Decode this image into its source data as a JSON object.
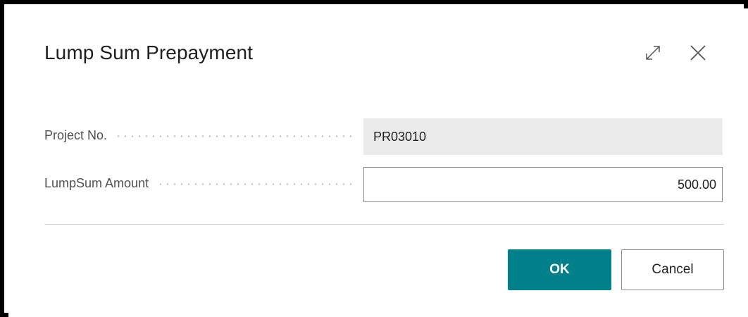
{
  "dialog": {
    "title": "Lump Sum Prepayment",
    "expand_icon": "expand-icon",
    "close_icon": "close-icon"
  },
  "fields": {
    "project_no": {
      "label": "Project No.",
      "value": "PR03010"
    },
    "lumpsum_amount": {
      "label": "LumpSum Amount",
      "value": "500.00"
    }
  },
  "buttons": {
    "ok_label": "OK",
    "cancel_label": "Cancel"
  },
  "colors": {
    "accent": "#00808a",
    "readonly_bg": "#ebebeb",
    "frame": "#000000"
  }
}
